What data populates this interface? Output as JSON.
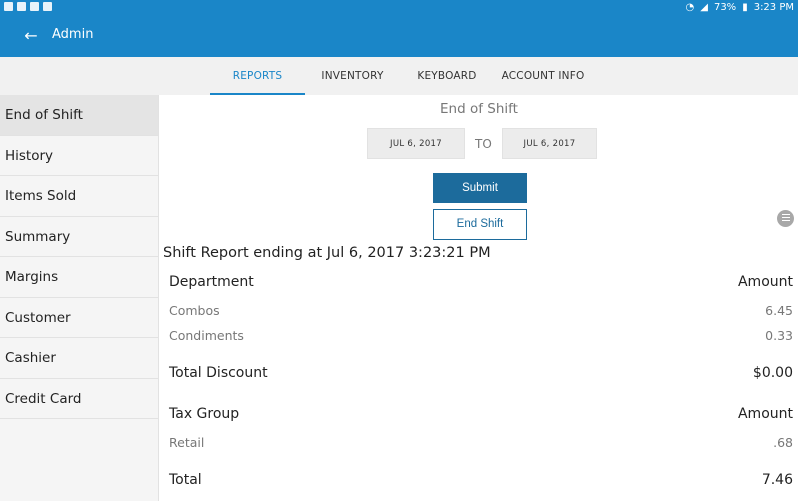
{
  "status_bar": {
    "time": "3:23 PM",
    "battery": "73%"
  },
  "app_bar": {
    "title": "Admin",
    "back_icon": "arrow-left-icon"
  },
  "tabs": [
    {
      "label": "REPORTS",
      "active": true
    },
    {
      "label": "INVENTORY",
      "active": false
    },
    {
      "label": "KEYBOARD",
      "active": false
    },
    {
      "label": "ACCOUNT INFO",
      "active": false
    }
  ],
  "sidebar": {
    "items": [
      {
        "label": "End of Shift",
        "active": true
      },
      {
        "label": "History"
      },
      {
        "label": "Items Sold"
      },
      {
        "label": "Summary"
      },
      {
        "label": "Margins"
      },
      {
        "label": "Customer"
      },
      {
        "label": "Cashier"
      },
      {
        "label": "Credit Card"
      }
    ]
  },
  "report_filters": {
    "title": "End of Shift",
    "from_date": "JUL 6, 2017",
    "to_label": "TO",
    "to_date": "JUL 6, 2017",
    "submit_label": "Submit",
    "end_shift_label": "End Shift"
  },
  "report": {
    "title": "Shift Report ending at Jul 6, 2017 3:23:21 PM",
    "department_header": {
      "label": "Department",
      "amount": "Amount"
    },
    "departments": [
      {
        "name": "Combos",
        "amount": "6.45"
      },
      {
        "name": "Condiments",
        "amount": "0.33"
      }
    ],
    "total_discount": {
      "label": "Total Discount",
      "amount": "$0.00"
    },
    "tax_header": {
      "label": "Tax Group",
      "amount": "Amount"
    },
    "tax_groups": [
      {
        "name": "Retail",
        "amount": ".68"
      }
    ],
    "total": {
      "label": "Total",
      "amount": "7.46"
    }
  },
  "colors": {
    "primary": "#1a86c8",
    "button": "#1c6b9c"
  }
}
